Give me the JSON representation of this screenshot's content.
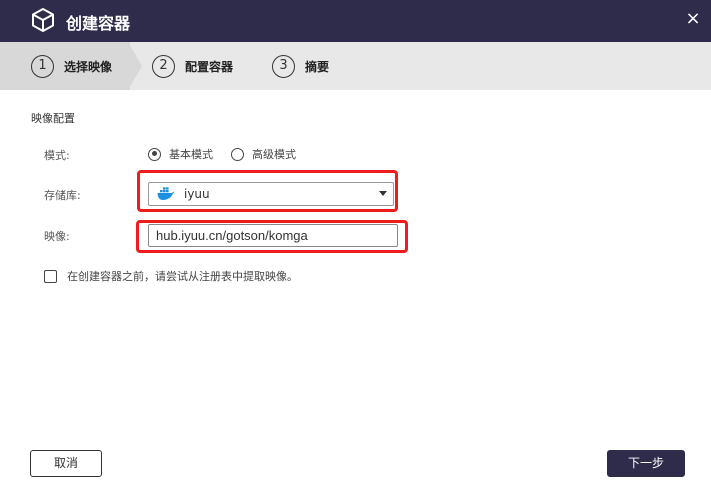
{
  "window": {
    "title": "创建容器",
    "close_label": "×"
  },
  "steps": [
    {
      "num": "1",
      "label": "选择映像"
    },
    {
      "num": "2",
      "label": "配置容器"
    },
    {
      "num": "3",
      "label": "摘要"
    }
  ],
  "form": {
    "section_title": "映像配置",
    "mode": {
      "label": "模式:",
      "options": [
        {
          "label": "基本模式",
          "checked": true
        },
        {
          "label": "高级模式",
          "checked": false
        }
      ]
    },
    "repo": {
      "label": "存储库:",
      "value": "iyuu",
      "icon": "docker-icon"
    },
    "image": {
      "label": "映像:",
      "value": "hub.iyuu.cn/gotson/komga"
    },
    "pull_checkbox": {
      "label": "在创建容器之前，请尝试从注册表中提取映像。",
      "checked": false
    }
  },
  "buttons": {
    "cancel": "取消",
    "next": "下一步"
  },
  "colors": {
    "titlebar": "#2e2c4a",
    "highlight": "#ee1c1c",
    "docker_blue": "#1d8fe0"
  }
}
